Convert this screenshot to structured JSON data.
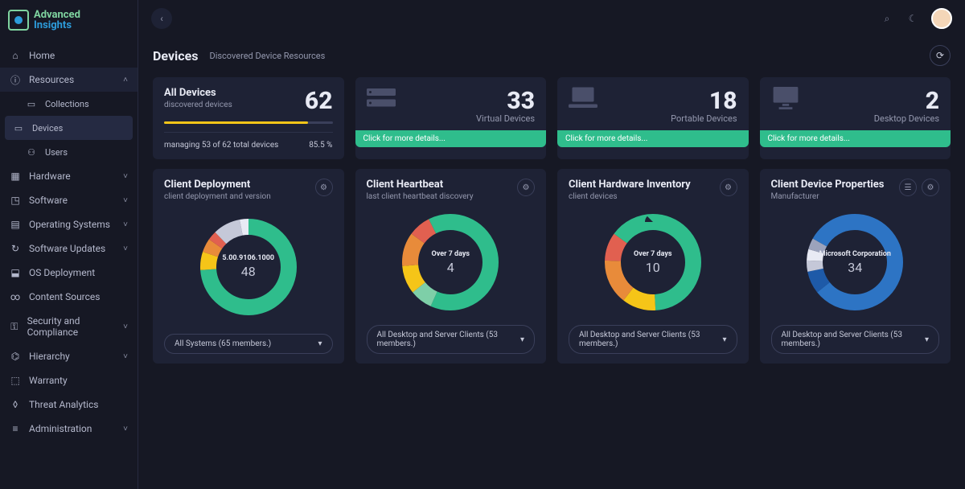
{
  "brand": {
    "line1": "Advanced",
    "line2": "Insights"
  },
  "nav": {
    "home": "Home",
    "resources": "Resources",
    "collections": "Collections",
    "devices": "Devices",
    "users": "Users",
    "hardware": "Hardware",
    "software": "Software",
    "os": "Operating Systems",
    "updates": "Software Updates",
    "osdeploy": "OS Deployment",
    "content": "Content Sources",
    "security": "Security and Compliance",
    "hierarchy": "Hierarchy",
    "warranty": "Warranty",
    "threat": "Threat Analytics",
    "admin": "Administration"
  },
  "header": {
    "title": "Devices",
    "subtitle": "Discovered Device Resources"
  },
  "summary": {
    "all": {
      "title": "All Devices",
      "sub": "discovered devices",
      "count": "62",
      "managing": "managing 53 of 62 total devices",
      "pct": "85.5 %",
      "progress_pct": 85.5
    },
    "virtual": {
      "count": "33",
      "label": "Virtual Devices",
      "details": "Click for more details..."
    },
    "portable": {
      "count": "18",
      "label": "Portable Devices",
      "details": "Click for more details..."
    },
    "desktop": {
      "count": "2",
      "label": "Desktop Devices",
      "details": "Click for more details..."
    }
  },
  "charts": [
    {
      "title": "Client Deployment",
      "sub": "client deployment and version",
      "center_label": "5.00.9106.1000",
      "center_value": "48",
      "dropdown": "All Systems (65 members.)",
      "type": "donut",
      "slices": [
        {
          "value": 48,
          "color": "#2fbd8c"
        },
        {
          "value": 4,
          "color": "#f5c518"
        },
        {
          "value": 3,
          "color": "#e88b3a"
        },
        {
          "value": 2,
          "color": "#e16050"
        },
        {
          "value": 6,
          "color": "#c5c8d8"
        },
        {
          "value": 2,
          "color": "#e8eaf4"
        }
      ]
    },
    {
      "title": "Client Heartbeat",
      "sub": "last client heartbeat discovery",
      "center_label": "Over 7 days",
      "center_value": "4",
      "dropdown": "All Desktop and Server Clients (53 members.)",
      "type": "donut",
      "slices": [
        {
          "value": 30,
          "color": "#2fbd8c"
        },
        {
          "value": 4,
          "color": "#7ecfa8"
        },
        {
          "value": 5,
          "color": "#f5c518"
        },
        {
          "value": 6,
          "color": "#e88b3a"
        },
        {
          "value": 4,
          "color": "#e16050"
        },
        {
          "value": 4,
          "color": "#2fbd8c"
        }
      ]
    },
    {
      "title": "Client Hardware Inventory",
      "sub": "client devices",
      "center_label": "Over 7 days",
      "center_value": "10",
      "dropdown": "All Desktop and Server Clients (53 members.)",
      "type": "donut",
      "slices": [
        {
          "value": 26,
          "color": "#2fbd8c"
        },
        {
          "value": 6,
          "color": "#f5c518"
        },
        {
          "value": 8,
          "color": "#e88b3a"
        },
        {
          "value": 5,
          "color": "#e16050"
        },
        {
          "value": 8,
          "color": "#2fbd8c"
        }
      ]
    },
    {
      "title": "Client Device Properties",
      "sub": "Manufacturer",
      "center_label": "Microsoft Corporation",
      "center_value": "34",
      "dropdown": "All Desktop and Server Clients (53 members.)",
      "type": "donut",
      "slices": [
        {
          "value": 34,
          "color": "#2d74c4"
        },
        {
          "value": 4,
          "color": "#1e5aa8"
        },
        {
          "value": 2,
          "color": "#c5c8d8"
        },
        {
          "value": 2,
          "color": "#e8eaf4"
        },
        {
          "value": 2,
          "color": "#9ca3bc"
        },
        {
          "value": 9,
          "color": "#2d74c4"
        }
      ]
    }
  ],
  "chart_data": [
    {
      "type": "donut",
      "title": "Client Deployment",
      "center": "5.00.9106.1000",
      "center_value": 48,
      "segments": [
        48,
        4,
        3,
        2,
        6,
        2
      ]
    },
    {
      "type": "donut",
      "title": "Client Heartbeat",
      "center": "Over 7 days",
      "center_value": 4,
      "segments": [
        30,
        4,
        5,
        6,
        4,
        4
      ]
    },
    {
      "type": "donut",
      "title": "Client Hardware Inventory",
      "center": "Over 7 days",
      "center_value": 10,
      "segments": [
        26,
        6,
        8,
        5,
        8
      ]
    },
    {
      "type": "donut",
      "title": "Client Device Properties",
      "center": "Microsoft Corporation",
      "center_value": 34,
      "segments": [
        34,
        4,
        2,
        2,
        2,
        9
      ]
    }
  ]
}
